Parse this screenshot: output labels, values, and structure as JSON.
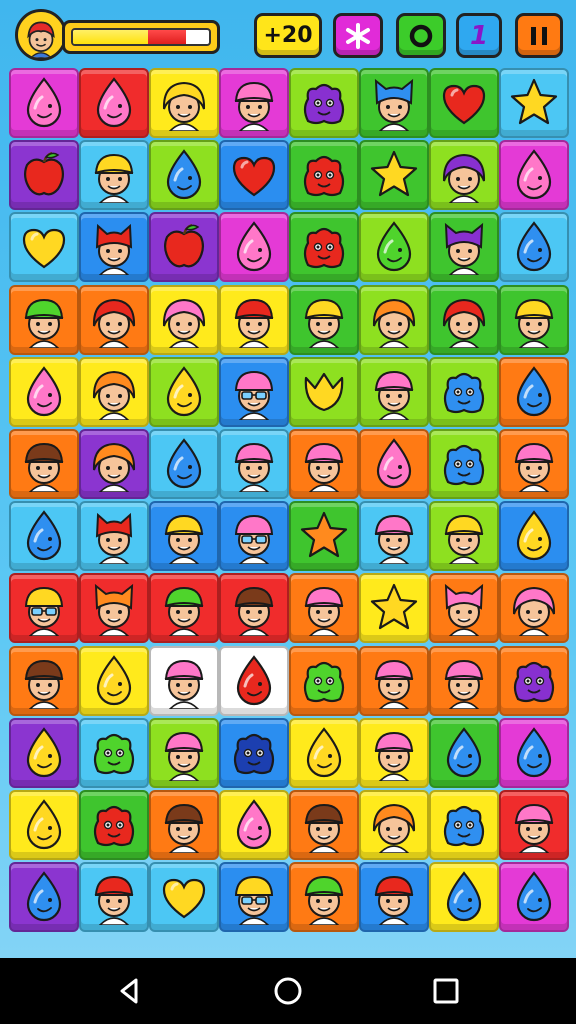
{
  "hud": {
    "player_health": 0.55,
    "buttons": [
      {
        "id": "bonus",
        "label": "+20",
        "color": "#ffe51a",
        "icon": ""
      },
      {
        "id": "asterisk",
        "label": "",
        "color": "#e12bd8",
        "icon": "asterisk-icon"
      },
      {
        "id": "circle",
        "label": "",
        "color": "#3ccc2a",
        "icon": "ring-icon"
      },
      {
        "id": "one",
        "label": "1",
        "color": "#2fa8f0",
        "icon": ""
      },
      {
        "id": "pause",
        "label": "",
        "color": "#ff7a12",
        "icon": "pause-icon"
      }
    ]
  },
  "colors": {
    "magenta": "#e43ad6",
    "red": "#f02c2c",
    "yellow": "#ffea1c",
    "lime": "#8ee020",
    "green": "#3fc52e",
    "purple": "#8b35d0",
    "sky": "#4cc7f4",
    "blue": "#2b8ef0",
    "orange": "#ff7a14",
    "white": "#ffffff"
  },
  "board": {
    "rows": 12,
    "cols": 8,
    "tiles": [
      [
        [
          "magenta",
          "drop-pink"
        ],
        [
          "red",
          "drop-pink"
        ],
        [
          "yellow",
          "face-yellow-hair"
        ],
        [
          "magenta",
          "face-pink-hat"
        ],
        [
          "lime",
          "monster-purple"
        ],
        [
          "green",
          "face-cat-blue"
        ],
        [
          "green",
          "heart-red"
        ],
        [
          "sky",
          "star-yellow"
        ]
      ],
      [
        [
          "purple",
          "apple-red"
        ],
        [
          "sky",
          "face-yellow-hat"
        ],
        [
          "lime",
          "drop-blue"
        ],
        [
          "blue",
          "heart-red"
        ],
        [
          "green",
          "devil-red"
        ],
        [
          "green",
          "star-yellow"
        ],
        [
          "lime",
          "face-purple-hair"
        ],
        [
          "magenta",
          "drop-pink"
        ]
      ],
      [
        [
          "sky",
          "heart-yellow"
        ],
        [
          "blue",
          "face-devil-red"
        ],
        [
          "purple",
          "apple-red"
        ],
        [
          "magenta",
          "drop-pink"
        ],
        [
          "green",
          "monster-red"
        ],
        [
          "lime",
          "drop-green"
        ],
        [
          "green",
          "face-cat-purple"
        ],
        [
          "sky",
          "drop-blue"
        ]
      ],
      [
        [
          "orange",
          "face-green-hat"
        ],
        [
          "orange",
          "face-red-hair"
        ],
        [
          "yellow",
          "face-pink-hair"
        ],
        [
          "yellow",
          "face-red-hat"
        ],
        [
          "green",
          "face-yellow-hat"
        ],
        [
          "lime",
          "face-orange-hair"
        ],
        [
          "green",
          "face-red-hair"
        ],
        [
          "green",
          "face-yellow-hat"
        ]
      ],
      [
        [
          "yellow",
          "drop-pink"
        ],
        [
          "yellow",
          "face-orange-hair"
        ],
        [
          "lime",
          "drop-yellow"
        ],
        [
          "blue",
          "face-pink-glasses"
        ],
        [
          "lime",
          "tulip-yellow"
        ],
        [
          "lime",
          "face-pink-hat"
        ],
        [
          "lime",
          "monster-blue"
        ],
        [
          "orange",
          "drop-blue"
        ]
      ],
      [
        [
          "orange",
          "face-brown-hat"
        ],
        [
          "purple",
          "face-orange-hair"
        ],
        [
          "sky",
          "drop-blue"
        ],
        [
          "sky",
          "face-pink-hat"
        ],
        [
          "orange",
          "face-pink-hat"
        ],
        [
          "orange",
          "drop-pink"
        ],
        [
          "lime",
          "monster-blue"
        ],
        [
          "orange",
          "face-pink-hat"
        ]
      ],
      [
        [
          "sky",
          "drop-blue"
        ],
        [
          "sky",
          "face-devil-red"
        ],
        [
          "blue",
          "face-yellow-hat"
        ],
        [
          "blue",
          "face-pink-glasses"
        ],
        [
          "green",
          "star-orange"
        ],
        [
          "sky",
          "face-pink-hat"
        ],
        [
          "lime",
          "face-yellow-hat"
        ],
        [
          "blue",
          "drop-yellow"
        ]
      ],
      [
        [
          "red",
          "face-yellow-glasses"
        ],
        [
          "red",
          "face-cat-orange"
        ],
        [
          "red",
          "face-green-hat"
        ],
        [
          "red",
          "face-brown-hat"
        ],
        [
          "orange",
          "face-pink-hat"
        ],
        [
          "yellow",
          "star-yellow"
        ],
        [
          "orange",
          "face-cat-pink"
        ],
        [
          "orange",
          "face-pink-hair"
        ]
      ],
      [
        [
          "orange",
          "face-brown-hat"
        ],
        [
          "yellow",
          "drop-yellow"
        ],
        [
          "white",
          "face-pink-hat"
        ],
        [
          "white",
          "drop-red"
        ],
        [
          "orange",
          "monster-green"
        ],
        [
          "orange",
          "face-pink-hat"
        ],
        [
          "orange",
          "face-pink-hat"
        ],
        [
          "orange",
          "monster-purple"
        ]
      ],
      [
        [
          "purple",
          "drop-yellow"
        ],
        [
          "sky",
          "monster-green"
        ],
        [
          "lime",
          "face-pink-hat"
        ],
        [
          "blue",
          "monster-navy"
        ],
        [
          "yellow",
          "drop-yellow"
        ],
        [
          "yellow",
          "face-pink-hat"
        ],
        [
          "green",
          "drop-blue"
        ],
        [
          "magenta",
          "drop-blue"
        ]
      ],
      [
        [
          "yellow",
          "drop-yellow"
        ],
        [
          "green",
          "monster-red"
        ],
        [
          "orange",
          "face-brown-hat"
        ],
        [
          "yellow",
          "drop-pink"
        ],
        [
          "orange",
          "face-brown-hat"
        ],
        [
          "yellow",
          "face-orange-hair"
        ],
        [
          "yellow",
          "monster-blue"
        ],
        [
          "red",
          "face-pink-hat"
        ]
      ],
      [
        [
          "purple",
          "drop-blue"
        ],
        [
          "sky",
          "face-red-hat"
        ],
        [
          "sky",
          "heart-yellow"
        ],
        [
          "blue",
          "face-yellow-glasses"
        ],
        [
          "orange",
          "face-green-hat"
        ],
        [
          "blue",
          "face-red-hat"
        ],
        [
          "yellow",
          "drop-blue"
        ],
        [
          "magenta",
          "drop-blue"
        ]
      ]
    ]
  },
  "navbar": [
    "back-icon",
    "home-icon",
    "recents-icon"
  ]
}
